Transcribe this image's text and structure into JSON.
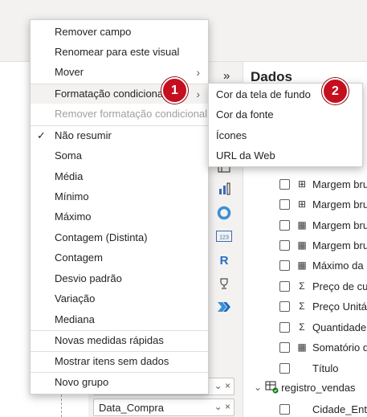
{
  "context_menu": {
    "items": [
      {
        "label": "Remover campo"
      },
      {
        "label": "Renomear para este visual"
      },
      {
        "label": "Mover"
      },
      {
        "label": "Formatação condicional"
      },
      {
        "label": "Remover formatação condicional"
      },
      {
        "label": "Não resumir"
      },
      {
        "label": "Soma"
      },
      {
        "label": "Média"
      },
      {
        "label": "Mínimo"
      },
      {
        "label": "Máximo"
      },
      {
        "label": "Contagem (Distinta)"
      },
      {
        "label": "Contagem"
      },
      {
        "label": "Desvio padrão"
      },
      {
        "label": "Variação"
      },
      {
        "label": "Mediana"
      },
      {
        "label": "Novas medidas rápidas"
      },
      {
        "label": "Mostrar itens sem dados"
      },
      {
        "label": "Novo grupo"
      }
    ],
    "checked_glyph": "✓",
    "submenu_arrow": "›"
  },
  "submenu": {
    "items": [
      {
        "label": "Cor da tela de fundo"
      },
      {
        "label": "Cor da fonte"
      },
      {
        "label": "Ícones"
      },
      {
        "label": "URL da Web"
      }
    ]
  },
  "badges": [
    "1",
    "2"
  ],
  "data_pane": {
    "title": "Dados",
    "expand_glyph": "»",
    "fields": [
      {
        "label": "Margem bru",
        "icon": "measure-icon"
      },
      {
        "label": "Margem bru",
        "icon": "measure-icon"
      },
      {
        "label": "Margem bru",
        "icon": "calculator-icon"
      },
      {
        "label": "Margem bru",
        "icon": "calculator-icon"
      },
      {
        "label": "Máximo da",
        "icon": "calculator-icon"
      },
      {
        "label": "Preço de cus",
        "icon": "sigma-icon"
      },
      {
        "label": "Preço Unitár",
        "icon": "sigma-icon"
      },
      {
        "label": "Quantidade",
        "icon": "sigma-icon"
      },
      {
        "label": "Somatório d",
        "icon": "calculator-icon"
      },
      {
        "label": "Título",
        "icon": ""
      }
    ],
    "table": {
      "name": "registro_vendas"
    },
    "sub_field": {
      "label": "Cidade_Entr"
    }
  },
  "field_wells": [
    {
      "label": ""
    },
    {
      "label": "Data_Compra"
    }
  ],
  "field_well_controls": {
    "chevron": "⌄",
    "close": "×"
  },
  "viz_icons": {
    "r_label": "R",
    "num_label": "123"
  },
  "colors": {
    "badge": "#c50f1f",
    "menu_hover": "#f3f2f1",
    "disabled_text": "#a19f9d"
  }
}
